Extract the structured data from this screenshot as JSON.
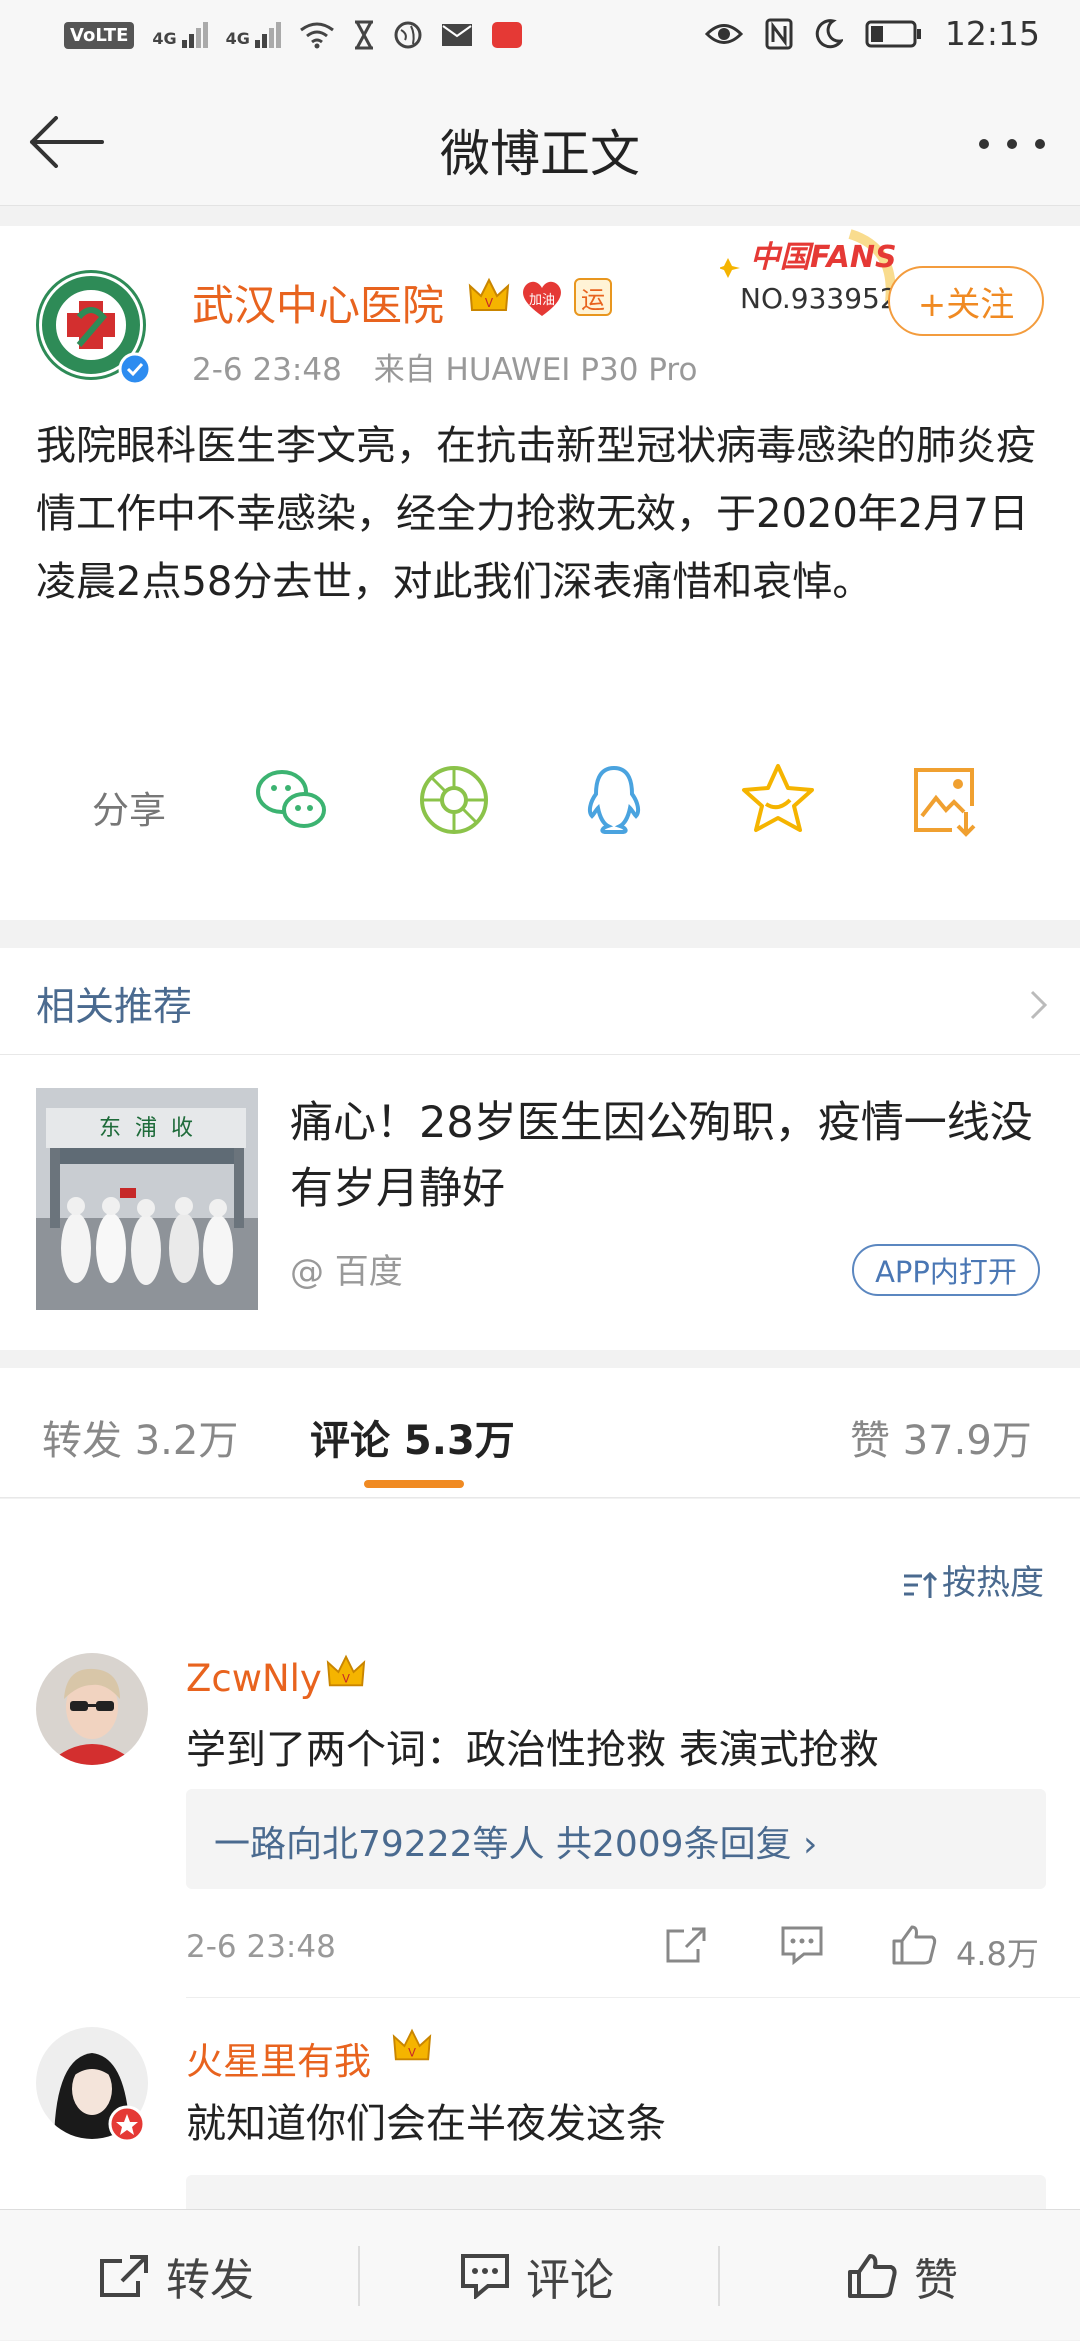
{
  "status_bar": {
    "volte": "VoLTE",
    "network1": "4G",
    "network2": "4G",
    "time": "12:15"
  },
  "nav": {
    "title": "微博正文"
  },
  "post": {
    "author": "武汉中心医院",
    "badge_jiayou": "加油",
    "badge_yun": "运",
    "fans_label": "中国FANS",
    "fans_number": "NO.933952",
    "follow_label": "+关注",
    "time": "2-6 23:48",
    "source": "来自 HUAWEI P30 Pro",
    "text": "我院眼科医生李文亮，在抗击新型冠状病毒感染的肺炎疫情工作中不幸感染，经全力抢救无效，于2020年2月7日凌晨2点58分去世，对此我们深表痛惜和哀悼。",
    "share_label": "分享"
  },
  "related": {
    "header": "相关推荐",
    "article_title": "痛心！28岁医生因公殉职，疫情一线没有岁月静好",
    "source": "@ 百度",
    "open_app": "APP内打开",
    "thumb_sign": "东  浦  收"
  },
  "tabs": {
    "repost": "转发 3.2万",
    "comment": "评论 5.3万",
    "like": "赞 37.9万"
  },
  "comments": {
    "sort_label": "按热度",
    "items": [
      {
        "name": "ZcwNly",
        "text": "学到了两个词：政治性抢救 表演式抢救",
        "replies": "一路向北79222等人  共2009条回复 ›",
        "time": "2-6 23:48",
        "likes": "4.8万"
      },
      {
        "name": "火星里有我",
        "text": "就知道你们会在半夜发这条"
      }
    ]
  },
  "bottom_bar": {
    "repost": "转发",
    "comment": "评论",
    "like": "赞"
  },
  "colors": {
    "accent": "#f08a22",
    "username": "#e8631e",
    "link": "#4a6a8f"
  }
}
